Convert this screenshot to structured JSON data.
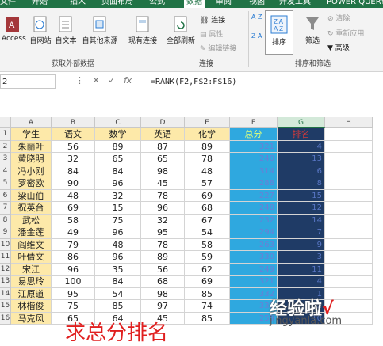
{
  "tabs": [
    "文件",
    "开始",
    "插入",
    "页面布局",
    "公式",
    "数据",
    "审阅",
    "视图",
    "开发工具",
    "POWER QUERY"
  ],
  "active_tab": "数据",
  "ribbon": {
    "access": "Access",
    "web": "自网站",
    "text": "自文本",
    "other": "自其他来源",
    "existing": "现有连接",
    "refresh": "全部刷新",
    "connections": "连接",
    "properties": "属性",
    "edit_links": "编辑链接",
    "sort": "排序",
    "filter": "筛选",
    "clear": "清除",
    "reapply": "重新应用",
    "advanced": "高级",
    "group_get_data": "获取外部数据",
    "group_connections": "连接",
    "group_sort_filter": "排序和筛选",
    "sort_az": "A Z",
    "sort_za": "Z A"
  },
  "formula_bar": {
    "name_box": "2",
    "formula": "=RANK(F2,F$2:F$16)"
  },
  "columns": [
    "A",
    "B",
    "C",
    "D",
    "E",
    "F",
    "G",
    "H"
  ],
  "selected_column": "G",
  "headers": [
    "学生",
    "语文",
    "数学",
    "英语",
    "化学",
    "总分",
    "排名"
  ],
  "rows": [
    [
      "朱丽叶",
      "56",
      "89",
      "87",
      "89",
      "321",
      "4"
    ],
    [
      "黄晓明",
      "32",
      "65",
      "65",
      "78",
      "240",
      "13"
    ],
    [
      "冯小刚",
      "84",
      "84",
      "98",
      "48",
      "314",
      "6"
    ],
    [
      "罗密欧",
      "90",
      "96",
      "45",
      "57",
      "288",
      "8"
    ],
    [
      "梁山伯",
      "48",
      "32",
      "78",
      "69",
      "227",
      "15"
    ],
    [
      "祝英台",
      "69",
      "15",
      "96",
      "68",
      "248",
      "12"
    ],
    [
      "武松",
      "58",
      "75",
      "32",
      "67",
      "232",
      "14"
    ],
    [
      "潘金莲",
      "49",
      "96",
      "95",
      "54",
      "294",
      "7"
    ],
    [
      "阎维文",
      "79",
      "48",
      "78",
      "58",
      "263",
      "9"
    ],
    [
      "叶倩文",
      "86",
      "96",
      "89",
      "59",
      "330",
      "3"
    ],
    [
      "宋江",
      "96",
      "35",
      "56",
      "62",
      "249",
      "11"
    ],
    [
      "易思玲",
      "100",
      "84",
      "68",
      "69",
      "321",
      "4"
    ],
    [
      "江原道",
      "95",
      "54",
      "98",
      "85",
      "332",
      "1"
    ],
    [
      "林楷俊",
      "75",
      "85",
      "97",
      "74",
      "331",
      "2"
    ],
    [
      "马克风",
      "65",
      "64",
      "45",
      "85",
      "259",
      "10"
    ]
  ],
  "row_numbers": [
    "1",
    "2",
    "3",
    "4",
    "5",
    "6",
    "7",
    "8",
    "9",
    "10",
    "11",
    "12",
    "13",
    "14",
    "15",
    "16"
  ],
  "caption": "求总分排名",
  "watermark": {
    "brand": "经验啦",
    "check": "√",
    "url": "jingyanla.com"
  },
  "colors": {
    "ribbon_green": "#217346",
    "sum_fill": "#2fa8df",
    "rank_fill": "#1f3b66",
    "name_fill": "#fde9a9"
  }
}
